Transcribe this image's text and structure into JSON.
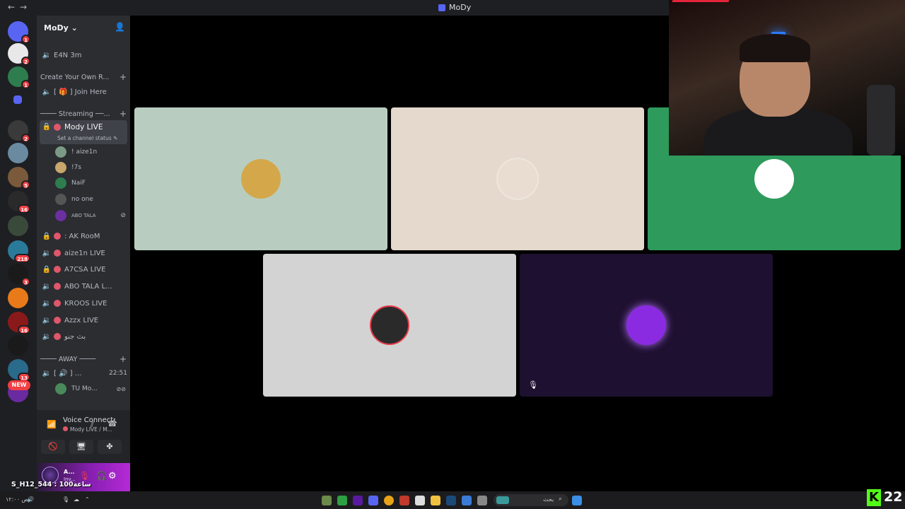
{
  "window": {
    "title": "MoDy"
  },
  "server": {
    "name": "MoDy"
  },
  "channels_top": [
    {
      "name": "E4N 3m"
    }
  ],
  "category_create": {
    "label": "Create Your Own R..."
  },
  "join_here": {
    "label": "[ 🎁 ] Join Here"
  },
  "category_streaming": {
    "label": "──── Streaming ──..."
  },
  "active_channel": {
    "name": "Mody LIVE",
    "status_placeholder": "Set a channel status"
  },
  "voice_users": [
    {
      "name": "! aize1n",
      "color": "#7a9a86"
    },
    {
      "name": "!7s",
      "color": "#c9a66b"
    },
    {
      "name": "NaiF",
      "color": "#2e7d4f"
    },
    {
      "name": "no one",
      "color": "#555555"
    },
    {
      "name": "ABO TALA",
      "color": "#6b2fa0"
    }
  ],
  "live_channels": [
    {
      "name": ": AK RooM",
      "locked": true
    },
    {
      "name": "aize1n LIVE",
      "locked": false
    },
    {
      "name": "A7CSA LIVE",
      "locked": true
    },
    {
      "name": "ABO TALA L...",
      "locked": false
    },
    {
      "name": "KROOS LIVE",
      "locked": false
    },
    {
      "name": "Azzx LIVE",
      "locked": false
    },
    {
      "name": "بث جنو",
      "locked": false
    }
  ],
  "category_away": {
    "label": "──── AWAY ────"
  },
  "away_channel": {
    "name": "[ 🔊 ] ...",
    "time": "22:51"
  },
  "away_user": {
    "name": "TU Mo..."
  },
  "servers": [
    {
      "badge": "1",
      "color": "#5865f2"
    },
    {
      "badge": "2",
      "color": "#e8e8e8"
    },
    {
      "badge": "1",
      "color": "#2e7d4f"
    },
    {
      "badge": "",
      "color": "#5865f2"
    },
    {
      "badge": "2",
      "color": "#3a3a3a"
    },
    {
      "badge": "",
      "color": "#6a8aa0"
    },
    {
      "badge": "5",
      "color": "#7a5a3a"
    },
    {
      "badge": "16",
      "color": "#2a2a2a"
    },
    {
      "badge": "",
      "color": "#3a4a3a"
    },
    {
      "badge": "218",
      "color": "#2a7a9a"
    },
    {
      "badge": "3",
      "color": "#1a1a1a"
    },
    {
      "badge": "",
      "color": "#e87a1a"
    },
    {
      "badge": "16",
      "color": "#8a1a1a"
    },
    {
      "badge": "",
      "color": "#1a1a1a"
    },
    {
      "badge": "13",
      "color": "#2a6a8a"
    },
    {
      "badge": "",
      "color": "#6a2aa0"
    }
  ],
  "new_badge": "NEW",
  "voice_panel": {
    "title": "Voice Connected",
    "subtitle": "Mody LIVE / M..."
  },
  "user_panel": {
    "name": "A...",
    "status": "Inv..."
  },
  "overlay_text": "S_H12_544 : 100ساعة",
  "tiles": [
    {
      "bg": "#b8cdc0",
      "pfp": "#d4a84a"
    },
    {
      "bg": "#e4d9cc",
      "pfp": "#e8ddd0"
    },
    {
      "bg": "#2e9a5c",
      "pfp": "#ffffff"
    },
    {
      "bg": "#d3d3d3",
      "pfp": "#2a2a2a"
    },
    {
      "bg": "#1e1030",
      "pfp": "#8a2be2"
    }
  ],
  "taskbar": {
    "search_placeholder": "بحث",
    "kick_count": "22",
    "kick_letter": "K"
  }
}
